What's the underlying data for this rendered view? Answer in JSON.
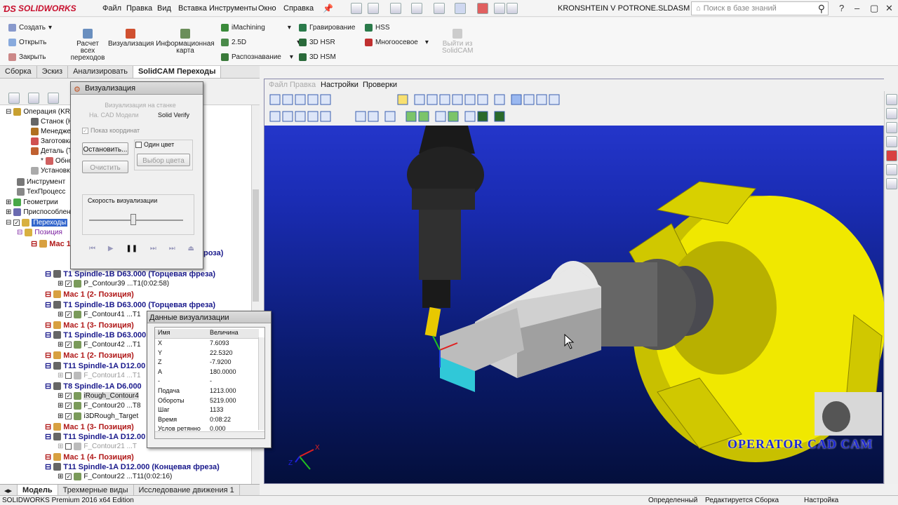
{
  "app": {
    "brand": "SOLIDWORKS",
    "doc_title": "KRONSHTEIN V POTRONE.SLDASM *",
    "kb_placeholder": "Поиск в базе знаний"
  },
  "menu": [
    "Файл",
    "Правка",
    "Вид",
    "Вставка",
    "Инструменты",
    "Окно",
    "Справка"
  ],
  "cmd": {
    "create": "Создать",
    "open": "Открыть",
    "close": "Закрыть",
    "calc": "Расчет всех переходов",
    "visual": "Визуализация",
    "info": "Информационная карта",
    "imachining": "iMachining",
    "d25": "2.5D",
    "recog": "Распознавание",
    "engrave": "Гравирование",
    "hsr": "3D HSR",
    "hsm": "3D HSM",
    "hss": "HSS",
    "multi": "Многоосевое",
    "exit": "Выйти из SolidCAM"
  },
  "tabs": [
    "Сборка",
    "Эскиз",
    "Анализировать",
    "SolidCAM Переходы"
  ],
  "viewport_menu": [
    "Файл",
    "Правка",
    "Настройки",
    "Проверки"
  ],
  "tree": {
    "r1": "Операция (KRO",
    "r2": "Станок (Н",
    "r3": "Менеджер",
    "r4": "Заготовка",
    "r5": "Деталь (Т",
    "r6": "Обнови",
    "r7": "Установк",
    "r8": "Инструмент",
    "r9": "ТехПроцесс",
    "r10": "Геометрии",
    "r11": "Приспособлен",
    "r12": "Переходы",
    "r13": "Позиция",
    "r14": "Мас 1",
    "r15": "T1 Spindle-1B D63.000  (Торцевая фреза)",
    "r16": "P_Contour39 ...T1(0:02:58)",
    "r17": "Мас 1 (2- Позиция)",
    "r18": "T1 Spindle-1B D63.000  (Торцевая фреза)",
    "r19": "F_Contour41 ...T1",
    "r20": "Мас 1 (3- Позиция)",
    "r21": "T1 Spindle-1B D63.000",
    "r22": "F_Contour42 ...T1",
    "r23": "Мас 1 (2- Позиция)",
    "r24": "T11 Spindle-1A D12.00",
    "r25": "F_Contour14 ...T1",
    "r26": "T8 Spindle-1A D6.000",
    "r27": "iRough_Contour4",
    "r28": "F_Contour20 ...T8",
    "r29": "i3DRough_Target",
    "r30": "Мас 1 (3- Позиция)",
    "r31": "T11 Spindle-1A D12.00",
    "r32": "F_Contour21 ...T",
    "r33": "Мас 1 (4- Позиция)",
    "r34": "T11 Spindle-1A D12.000  (Концевая фреза)",
    "r35": "F_Contour22 ...T11(0:02:16)",
    "r15b": "роза)"
  },
  "viz": {
    "title": "Визуализация",
    "sub": "Визуализация на станке",
    "tabA": "На. CAD Модели",
    "tabB": "Solid Verify",
    "coords": "Показ координат",
    "stop": "Остановить...",
    "clear": "Очистить",
    "onecolor": "Один цвет",
    "choosecolor": "Выбор цвета",
    "speed": "Скорость визуализации",
    "speed_level": 0.45
  },
  "data": {
    "title": "Данные визуализации",
    "h_name": "Имя",
    "h_val": "Величина",
    "rows": [
      {
        "n": "X",
        "v": "7.6093"
      },
      {
        "n": "Y",
        "v": "22.5320"
      },
      {
        "n": "Z",
        "v": "-7.9200"
      },
      {
        "n": "A",
        "v": "180.0000"
      },
      {
        "n": "-",
        "v": "-"
      },
      {
        "n": "Подача",
        "v": "1213.000"
      },
      {
        "n": "Обороты",
        "v": "5219.000"
      },
      {
        "n": "Шаг",
        "v": "1133"
      },
      {
        "n": "Время",
        "v": "0:08:22"
      },
      {
        "n": "Услов ретянно",
        "v": "0.000"
      }
    ]
  },
  "bottom_tabs": [
    "Модель",
    "Трехмерные виды",
    "Исследование движения 1"
  ],
  "status": {
    "left": "SOLIDWORKS Premium 2016 x64 Edition",
    "s1": "Определенный",
    "s2": "Редактируется Сборка",
    "s3": "Настройка"
  },
  "watermark": "OPERATOR CAD CAM",
  "axes": {
    "x": "X",
    "z": "Z"
  }
}
